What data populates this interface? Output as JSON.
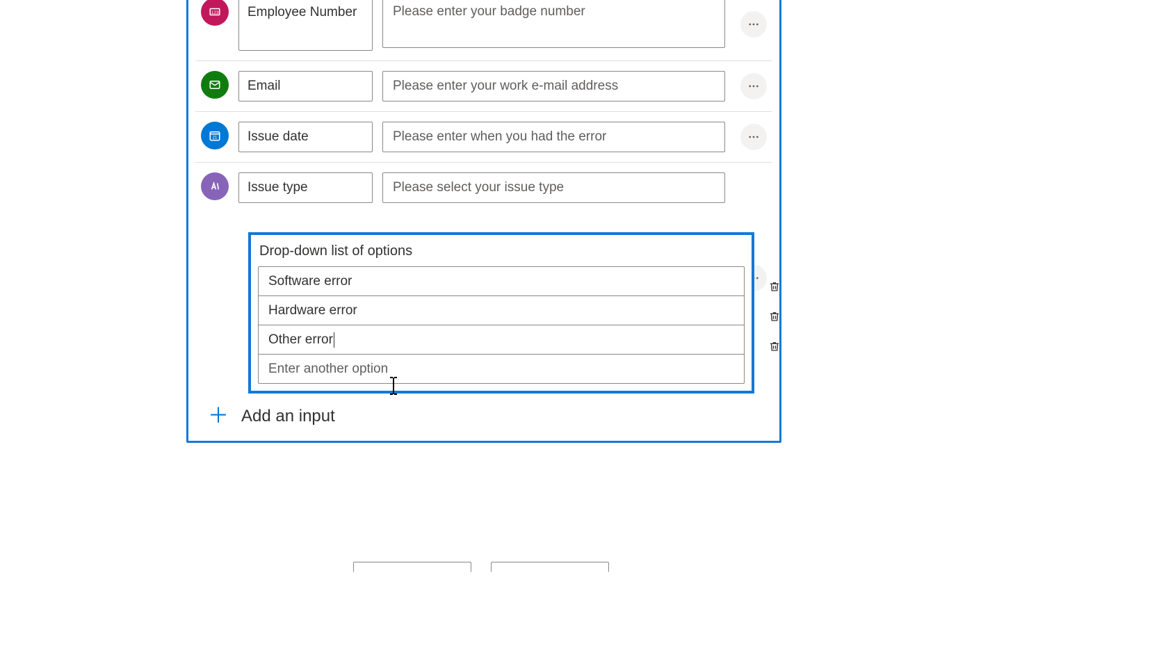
{
  "inputs": {
    "employee_number": {
      "label": "Employee Number",
      "prompt": "Please enter your badge number"
    },
    "email": {
      "label": "Email",
      "prompt": "Please enter your work e-mail address"
    },
    "issue_date": {
      "label": "Issue date",
      "prompt": "Please enter when you had the error"
    },
    "issue_type": {
      "label": "Issue type",
      "prompt": "Please select your issue type"
    }
  },
  "dropdown_editor": {
    "title": "Drop-down list of options",
    "options": [
      "Software error",
      "Hardware error",
      "Other error"
    ],
    "new_option_placeholder": "Enter another option"
  },
  "add_input_label": "Add an input"
}
